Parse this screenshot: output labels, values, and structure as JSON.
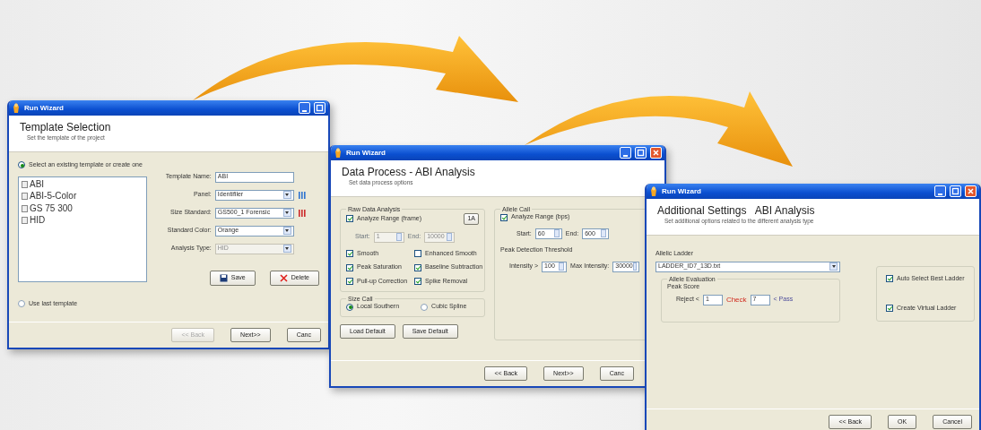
{
  "template_window": {
    "title": "Run Wizard",
    "heading": "Template Selection",
    "subheading": "Set the template of the project",
    "source_options": [
      {
        "label": "Select an existing template or create one",
        "selected": true
      },
      {
        "label": "Use last template",
        "selected": false
      }
    ],
    "templates": [
      "ABI",
      "ABI-5-Color",
      "GS 75 300",
      "HID"
    ],
    "fields": [
      {
        "label": "Template Name:",
        "value": "ABI",
        "kind": "text",
        "disabled": false
      },
      {
        "label": "Panel:",
        "value": "Identifiler",
        "kind": "dropdown",
        "disabled": false,
        "color": "#2f74d0"
      },
      {
        "label": "Size Standard:",
        "value": "GS500_1 Forensic",
        "kind": "dropdown",
        "disabled": false,
        "color": "#cc2a2a"
      },
      {
        "label": "Standard Color:",
        "value": "Orange",
        "kind": "dropdown",
        "disabled": false
      },
      {
        "label": "Analysis Type:",
        "value": "HID",
        "kind": "dropdown",
        "disabled": true
      }
    ],
    "actions": [
      {
        "label": "Save",
        "kind": "save"
      },
      {
        "label": "Delete",
        "kind": "delete"
      }
    ],
    "footer": [
      {
        "label": "<< Back",
        "disabled": true
      },
      {
        "label": "Next>>",
        "disabled": false
      },
      {
        "label": "Canc",
        "disabled": false
      }
    ]
  },
  "process_window": {
    "title": "Run Wizard",
    "heading": "Data Process - ABI Analysis",
    "subheading": "Set data process options",
    "raw_group": {
      "title": "Raw Data Analysis",
      "range": {
        "label": "Analyze Range (frame)",
        "checked": true
      },
      "range_button": "1A",
      "start": {
        "label": "Start:",
        "value": "1",
        "disabled": true
      },
      "end": {
        "label": "End:",
        "value": "10000",
        "disabled": true
      },
      "options": [
        {
          "label": "Smooth",
          "checked": true
        },
        {
          "label": "Enhanced Smooth",
          "checked": false
        },
        {
          "label": "Peak Saturation",
          "checked": true
        },
        {
          "label": "Baseline Subtraction",
          "checked": true
        },
        {
          "label": "Pull-up Correction",
          "checked": true
        },
        {
          "label": "Spike Removal",
          "checked": true
        }
      ]
    },
    "size_group": {
      "title": "Size Call",
      "methods": [
        {
          "label": "Local Southern",
          "selected": true
        },
        {
          "label": "Cubic Spline",
          "selected": false
        }
      ]
    },
    "default_buttons": [
      "Load Default",
      "Save Default"
    ],
    "allele_group": {
      "title": "Allele Call",
      "range": {
        "label": "Analyze Range (bps)",
        "checked": true
      },
      "start": {
        "label": "Start:",
        "value": "60",
        "disabled": false
      },
      "end": {
        "label": "End:",
        "value": "600",
        "disabled": false
      },
      "threshold_title": "Peak Detection Threshold",
      "intensity": {
        "label": "Intensity >",
        "value": "100",
        "disabled": false
      },
      "max_intensity": {
        "label": "Max Intensity:",
        "value": "30000",
        "disabled": false
      }
    },
    "footer": [
      {
        "label": "<< Back",
        "disabled": false
      },
      {
        "label": "Next>>",
        "disabled": false
      },
      {
        "label": "Canc",
        "disabled": false
      }
    ]
  },
  "settings_window": {
    "title": "Run Wizard",
    "heading": "Additional Settings   ABI Analysis",
    "subheading": "Set additional options related to the different analysis type",
    "ladder_label": "Allelic Ladder",
    "ladder": "LADDER_ID7_13D.txt",
    "evaluation": {
      "title": "Allele Evaluation",
      "score_title": "Peak Score",
      "reject_label": "Reject <",
      "reject": "1",
      "check_label": "Check",
      "check": "7",
      "pass_label": "< Pass"
    },
    "options": [
      {
        "label": "Auto Select Best Ladder",
        "checked": true
      },
      {
        "label": "Create Virtual Ladder",
        "checked": true
      }
    ],
    "footer": [
      {
        "label": "<< Back",
        "disabled": false
      },
      {
        "label": "OK",
        "disabled": false
      },
      {
        "label": "Cancel",
        "disabled": false
      }
    ]
  }
}
